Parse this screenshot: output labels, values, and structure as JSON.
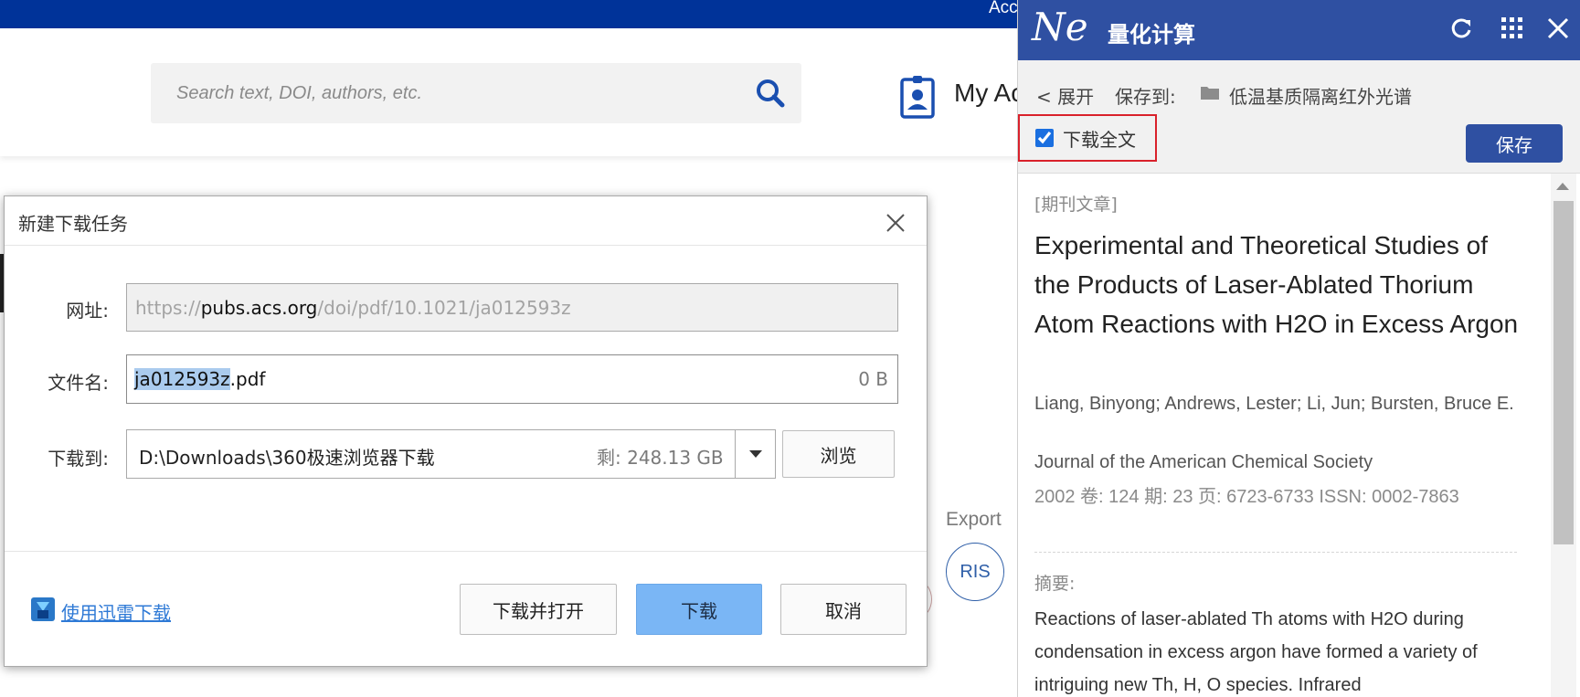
{
  "site": {
    "top_bar_text": "Acc",
    "search_placeholder": "Search text, DOI, authors, etc.",
    "account_text": "My Ac",
    "export_label": "Export",
    "ris_label": "RIS"
  },
  "dialog": {
    "title": "新建下载任务",
    "url_label": "网址:",
    "url_prefix": "https://",
    "url_host": "pubs.acs.org",
    "url_path": "/doi/pdf/10.1021/ja012593z",
    "filename_label": "文件名:",
    "filename_selected": "ja012593z",
    "filename_ext": ".pdf",
    "file_size": "0 B",
    "saveto_label": "下载到:",
    "save_path": "D:\\Downloads\\360极速浏览器下载",
    "free_space": "剩: 248.13 GB",
    "browse_label": "浏览",
    "xunlei_label": "使用迅雷下载",
    "download_open_label": "下载并打开",
    "download_label": "下载",
    "cancel_label": "取消"
  },
  "ne_panel": {
    "logo": "Ne",
    "title": "量化计算",
    "expand_label": "< 展开",
    "save_to_label": "保存到:",
    "folder_name": "低温基质隔离红外光谱",
    "download_full_label": "下载全文",
    "download_full_checked": true,
    "save_button": "保存",
    "article_type": "[期刊文章]",
    "article_title": "Experimental and Theoretical Studies of the Products of Laser-Ablated Thorium Atom Reactions with H2O in Excess Argon",
    "authors": "Liang, Binyong; Andrews, Lester; Li, Jun; Bursten, Bruce E.",
    "journal": "Journal of the American Chemical Society",
    "meta": "2002  卷: 124   期: 23   页: 6723-6733   ISSN: 0002-7863",
    "abstract_label": "摘要:",
    "abstract": "Reactions of laser-ablated Th atoms with H2O during condensation in excess argon have formed a variety of intriguing new Th, H, O species. Infrared"
  },
  "colors": {
    "site_blue": "#003399",
    "ne_header": "#2f50a2",
    "highlight_red": "#d9212b",
    "primary_button": "#7ab6f5",
    "selection": "#aacbee"
  }
}
